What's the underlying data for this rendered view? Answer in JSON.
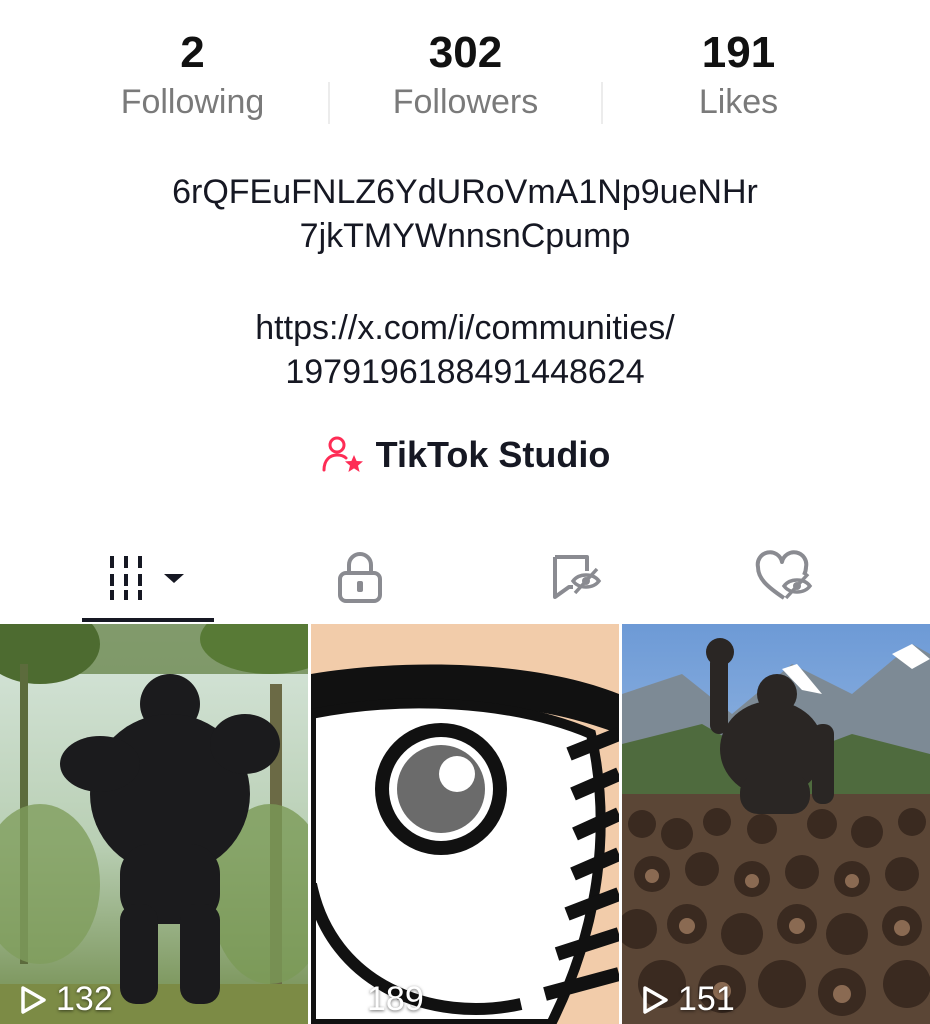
{
  "stats": {
    "following": {
      "count": "2",
      "label": "Following"
    },
    "followers": {
      "count": "302",
      "label": "Followers"
    },
    "likes": {
      "count": "191",
      "label": "Likes"
    }
  },
  "bio": {
    "line1": "6rQFEuFNLZ6YdURoVmA1Np9ueNHr",
    "line2": "7jkTMYWnnsnCpump",
    "link_line1": "https://x.com/i/communities/",
    "link_line2": "1979196188491448624"
  },
  "studio": {
    "label": "TikTok Studio",
    "icon": "person-star-icon",
    "icon_color": "#fe2c55"
  },
  "tabs": [
    {
      "icon": "videos-grid-icon",
      "selected": true
    },
    {
      "icon": "lock-icon",
      "selected": false
    },
    {
      "icon": "repost-hidden-icon",
      "selected": false
    },
    {
      "icon": "liked-hidden-icon",
      "selected": false
    }
  ],
  "videos": [
    {
      "views": "132",
      "description": "gorilla in jungle"
    },
    {
      "views": "189",
      "description": "cartoon eye closeup"
    },
    {
      "views": "151",
      "description": "gorilla leading crowd in mountains"
    }
  ],
  "colors": {
    "text": "#161823",
    "muted": "#7a7a7a",
    "accent": "#fe2c55"
  }
}
